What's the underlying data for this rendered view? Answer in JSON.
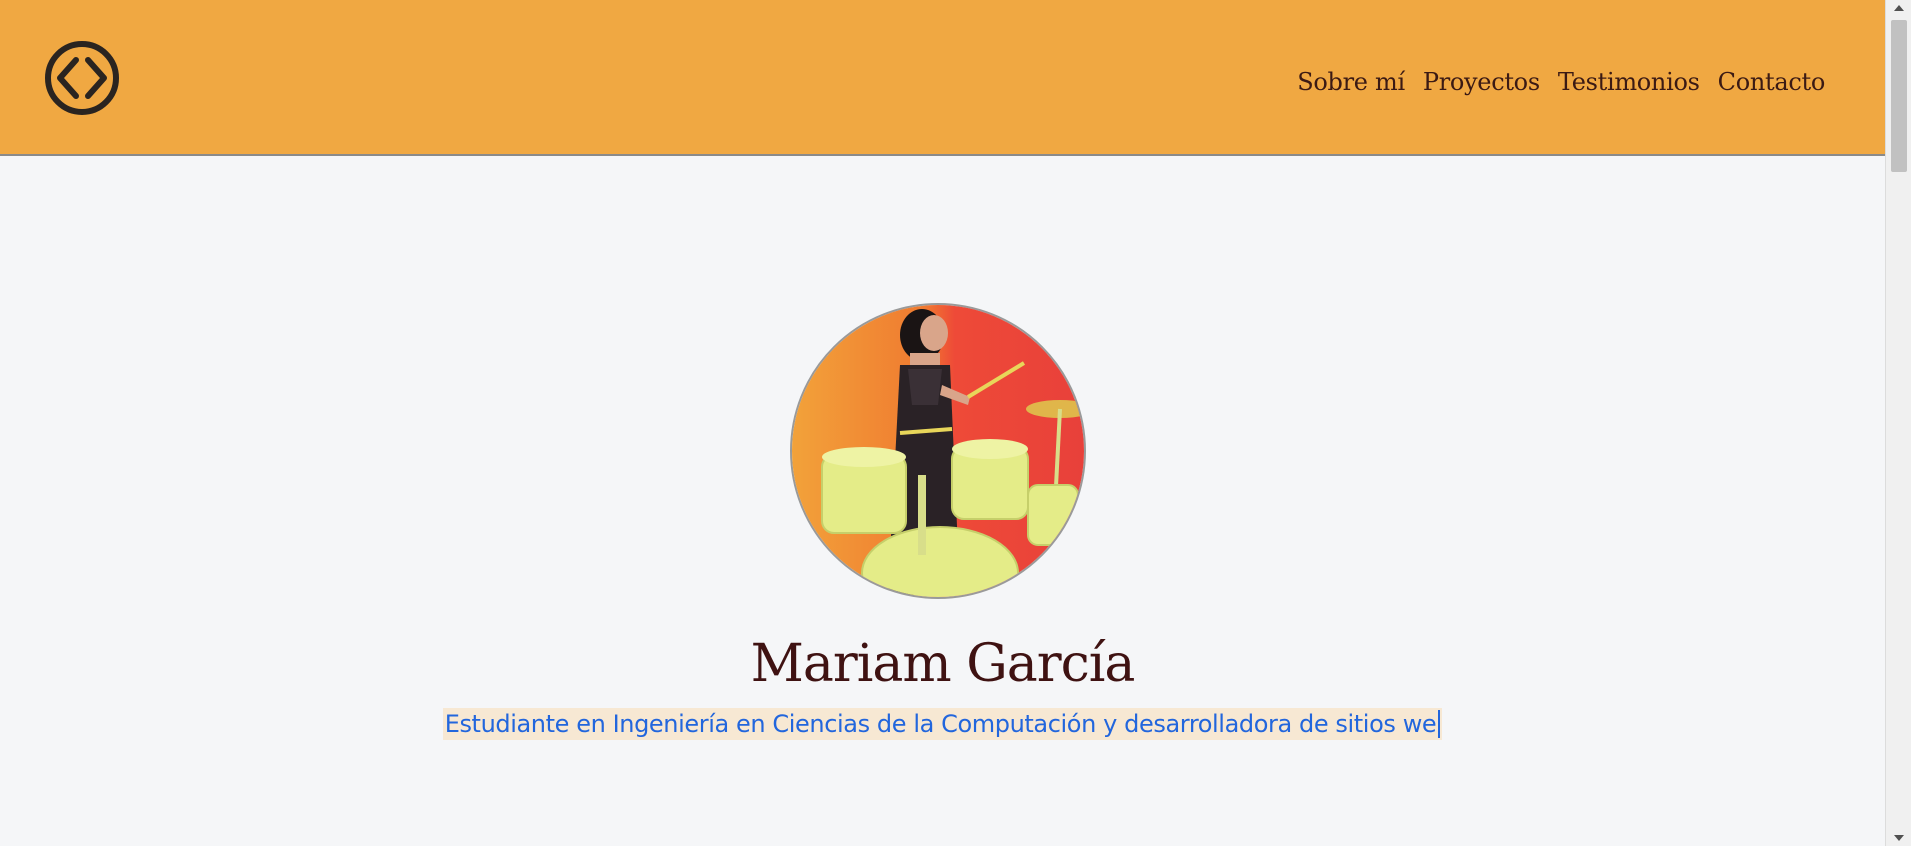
{
  "header": {
    "logo_icon": "code-brackets-circle-icon",
    "nav": [
      {
        "label": "Sobre mí"
      },
      {
        "label": "Proyectos"
      },
      {
        "label": "Testimonios"
      },
      {
        "label": "Contacto"
      }
    ]
  },
  "hero": {
    "name": "Mariam García",
    "tagline": "Estudiante en Ingeniería en Ciencias de la Computación y desarrolladora de sitios we"
  },
  "colors": {
    "header_bg": "#f0a842",
    "page_bg": "#f5f6f8",
    "nav_text": "#3b1a14",
    "name_text": "#3f1212",
    "tagline_text": "#2266dd",
    "tagline_highlight": "#f7e8d3"
  }
}
